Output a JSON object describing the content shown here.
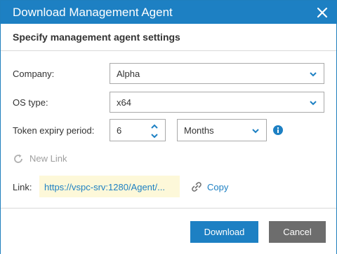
{
  "dialog": {
    "title": "Download Management Agent",
    "header": "Specify management agent settings"
  },
  "form": {
    "company_label": "Company:",
    "company_value": "Alpha",
    "os_label": "OS type:",
    "os_value": "x64",
    "token_label": "Token expiry period:",
    "token_value": "6",
    "period_value": "Months"
  },
  "links": {
    "new_link_label": "New Link",
    "link_label": "Link:",
    "link_value": "https://vspc-srv:1280/Agent/...",
    "copy_label": "Copy"
  },
  "footer": {
    "download_label": "Download",
    "cancel_label": "Cancel"
  },
  "colors": {
    "accent": "#1d80c3",
    "link_highlight": "#fdf8d9",
    "disabled_text": "#9e9e9e",
    "cancel_button": "#6d6d6d"
  },
  "icons": [
    "close-icon",
    "chevron-down-icon",
    "chevron-up-icon",
    "info-icon",
    "refresh-icon",
    "link-icon"
  ]
}
